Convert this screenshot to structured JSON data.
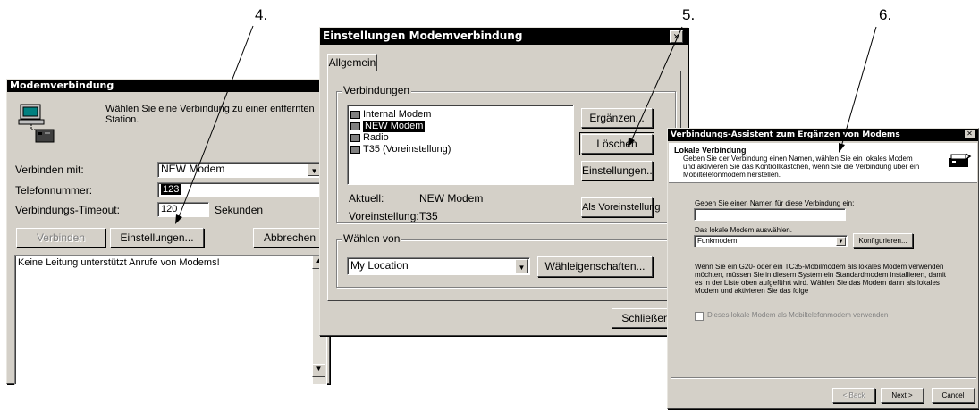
{
  "callouts": [
    "4.",
    "5.",
    "6."
  ],
  "win1": {
    "title": "Modemverbindung",
    "intro": "Wählen Sie eine Verbindung zu einer entfernten Station.",
    "connect_label": "Verbinden mit:",
    "connect_value": "NEW Modem",
    "phone_label": "Telefonnummer:",
    "phone_value": "123",
    "timeout_label": "Verbindungs-Timeout:",
    "timeout_value": "120",
    "seconds": "Sekunden",
    "btn_connect": "Verbinden",
    "btn_settings": "Einstellungen...",
    "btn_cancel": "Abbrechen",
    "log_text": "Keine Leitung unterstützt Anrufe von Modems!"
  },
  "win2": {
    "title": "Einstellungen Modemverbindung",
    "tab": "Allgemein",
    "group_connections": "Verbindungen",
    "connections": [
      "Internal Modem",
      "NEW Modem",
      "Radio",
      "T35 (Voreinstellung)"
    ],
    "selected_index": 1,
    "btn_add": "Ergänzen...",
    "btn_delete": "Löschen",
    "btn_settings": "Einstellungen...",
    "current_label": "Aktuell:",
    "current_value": "NEW Modem",
    "default_label": "Voreinstellung:",
    "default_value": "T35",
    "btn_set_default": "Als Voreinstellung",
    "group_dial": "Wählen von",
    "location": "My Location",
    "btn_dial_props": "Wähleigenschaften...",
    "btn_close": "Schließen"
  },
  "win3": {
    "title": "Verbindungs-Assistent zum Ergänzen von Modems",
    "header_title": "Lokale Verbindung",
    "header_desc": "Geben Sie der Verbindung einen Namen, wählen Sie ein lokales Modem und aktivieren Sie das Kontrollkästchen, wenn Sie die Verbindung über ein Mobiltelefonmodem herstellen.",
    "name_prompt": "Geben Sie einen Namen für diese Verbindung ein:",
    "name_value": "",
    "modem_prompt": "Das lokale Modem auswählen.",
    "modem_value": "Funkmodem",
    "btn_configure": "Konfigurieren...",
    "info": "Wenn Sie ein G20- oder ein TC35-Mobilmodem als lokales Modem verwenden möchten, müssen Sie in diesem System ein Standardmodem installieren, damit es in der Liste oben aufgeführt wird. Wählen Sie das Modem dann als lokales Modem und aktivieren Sie das folge",
    "checkbox_label": "Dieses lokale Modem als Mobiltelefonmodem verwenden",
    "btn_back": "< Back",
    "btn_next": "Next >",
    "btn_cancel": "Cancel"
  }
}
